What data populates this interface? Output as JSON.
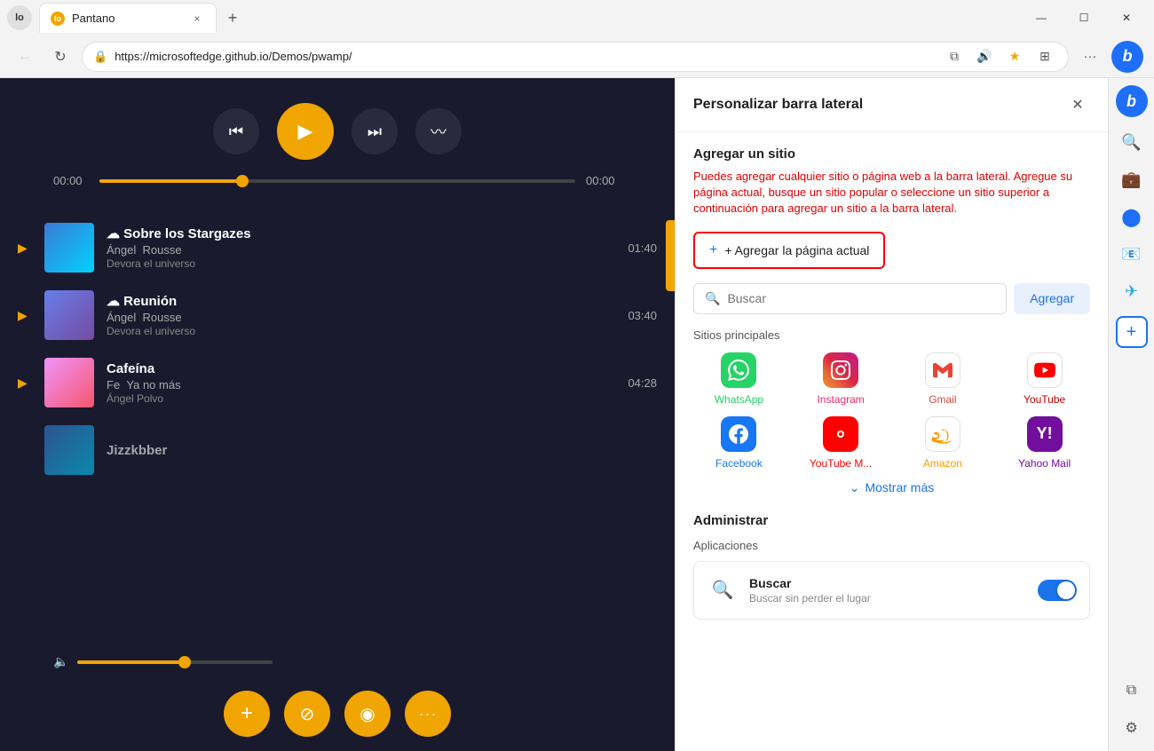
{
  "browser": {
    "tab": {
      "favicon_letter": "Io",
      "title": "Pantano",
      "close_label": "×"
    },
    "new_tab_label": "+",
    "window_controls": {
      "minimize": "—",
      "maximize": "☐",
      "close": "✕"
    },
    "address_bar": {
      "url": "https://microsoftedge.github.io/Demos/pwamp/",
      "lock_icon": "🔒"
    },
    "toolbar": {
      "more_label": "···"
    }
  },
  "panel": {
    "title": "Personalizar barra lateral",
    "close_label": "✕",
    "section_title": "Agregar un sitio",
    "section_desc": "Puedes agregar cualquier sitio o página web a la barra lateral. Agregue su página actual, busque un sitio popular o seleccione un sitio superior a continuación para agregar un sitio a la barra lateral.",
    "add_current_label": "+ Agregar la página actual",
    "search_placeholder": "Buscar",
    "add_button_label": "Agregar",
    "sites_title": "Sitios principales",
    "sites": [
      {
        "name": "WhatsApp",
        "color_class": "green",
        "bg_class": "bg-whatsapp",
        "emoji": "📱"
      },
      {
        "name": "Instagram",
        "color_class": "pink",
        "bg_class": "bg-instagram",
        "emoji": "📷"
      },
      {
        "name": "Gmail",
        "color_class": "red",
        "bg_class": "bg-gmail",
        "emoji": "✉️"
      },
      {
        "name": "YouTube",
        "color_class": "darkred",
        "bg_class": "bg-youtube",
        "emoji": "▶"
      },
      {
        "name": "Facebook",
        "color_class": "blue",
        "bg_class": "bg-facebook",
        "emoji": "f"
      },
      {
        "name": "YouTube M...",
        "color_class": "orange-red",
        "bg_class": "bg-ytmusic",
        "emoji": "♪"
      },
      {
        "name": "Amazon",
        "color_class": "amazon",
        "bg_class": "bg-amazon",
        "emoji": "📦"
      },
      {
        "name": "Yahoo Mail",
        "color_class": "purple",
        "bg_class": "bg-yahoomail",
        "emoji": "Y!"
      }
    ],
    "show_more_label": "⌄ Mostrar más",
    "admin_title": "Administrar",
    "apps_subtitle": "Aplicaciones",
    "app": {
      "name": "Buscar",
      "desc": "Buscar sin perder el lugar",
      "icon": "🔍"
    }
  },
  "player": {
    "controls": {
      "prev_label": "⏮",
      "play_label": "▶",
      "next_label": "⏭",
      "wave_label": "〰"
    },
    "time_start": "00:00",
    "time_end": "00:00",
    "playlist": [
      {
        "title": "☁ Sobre los Stargazes",
        "artist": "Ángel",
        "artist2": "Rousse",
        "album": "Devora el universo",
        "duration": "01:40",
        "art_class": "art1"
      },
      {
        "title": "☁ Reunión",
        "artist": "Ángel",
        "artist2": "Rousse",
        "album": "Devora el universo",
        "duration": "03:40",
        "art_class": "art2"
      },
      {
        "title": "Cafeína",
        "artist": "Fe",
        "artist2": "Ya no más",
        "album": "Ángel Polvo",
        "duration": "04:28",
        "art_class": "art3"
      },
      {
        "title": "Jizzkbber",
        "artist": "",
        "artist2": "",
        "album": "",
        "duration": "",
        "art_class": "art1",
        "partial": true
      }
    ],
    "bottom_buttons": [
      {
        "icon": "+",
        "name": "add-button"
      },
      {
        "icon": "⊘",
        "name": "compass-button"
      },
      {
        "icon": "◉",
        "name": "record-button"
      },
      {
        "icon": "···",
        "name": "more-button"
      }
    ]
  },
  "browser_sidebar": {
    "icons": [
      {
        "name": "bing-chat-icon",
        "symbol": "b",
        "active": false
      },
      {
        "name": "search-sidebar-icon",
        "symbol": "🔍",
        "active": false
      },
      {
        "name": "briefcase-icon",
        "symbol": "💼",
        "active": false
      },
      {
        "name": "discover-icon",
        "symbol": "🔵",
        "active": false
      },
      {
        "name": "outlook-icon",
        "symbol": "📧",
        "active": false
      },
      {
        "name": "telegram-icon",
        "symbol": "✈",
        "active": false
      },
      {
        "name": "add-sidebar-icon",
        "symbol": "+",
        "active": true
      }
    ],
    "bottom": [
      {
        "name": "split-screen-icon",
        "symbol": "⧉"
      },
      {
        "name": "settings-icon",
        "symbol": "⚙"
      }
    ]
  }
}
